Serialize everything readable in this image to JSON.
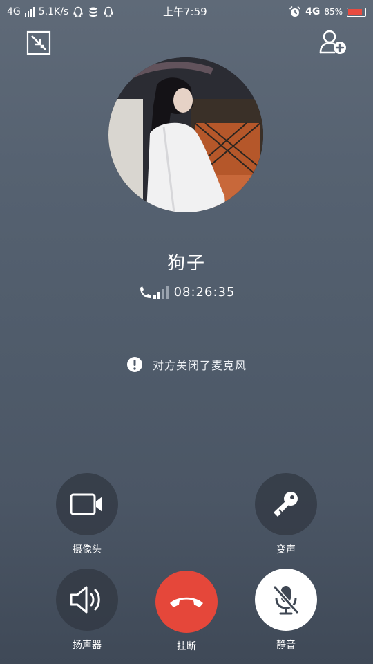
{
  "status_bar": {
    "network_left": "4G",
    "speed": "5.1K/s",
    "time": "上午7:59",
    "network_right": "4G",
    "battery_percent": "85%",
    "battery_level": 0.85
  },
  "call": {
    "caller_name": "狗子",
    "duration": "08:26:35",
    "notice": "对方关闭了麦克风"
  },
  "controls": {
    "camera_label": "摄像头",
    "voice_changer_label": "变声",
    "speaker_label": "扬声器",
    "hangup_label": "挂断",
    "mute_label": "静音"
  },
  "colors": {
    "hangup": "#e5473a",
    "battery_fill": "#e84b40"
  }
}
